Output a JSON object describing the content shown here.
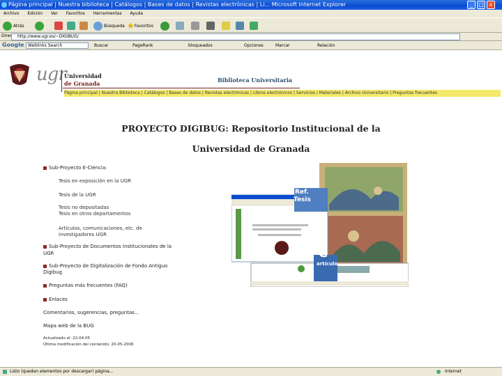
{
  "window": {
    "title": "Página principal | Nuestra biblioteca | Catálogos | Bases de datos | Revistas electrónicas | Li... Microsoft Internet Explorer",
    "buttons": [
      "_",
      "□",
      "x"
    ]
  },
  "menubar": [
    "Archivo",
    "Edición",
    "Ver",
    "Favoritos",
    "Herramientas",
    "Ayuda"
  ],
  "toolbar": {
    "back": "Atrás",
    "search": "Búsqueda",
    "favorites": "Favoritos"
  },
  "addressbar": {
    "label": "Dirección",
    "url": "http://www.ugr.es/~DIGIBUG/"
  },
  "googlebar": {
    "logo": "Google",
    "search_value": "Weblinks Search",
    "items": [
      "Buscar",
      "PageRank",
      "bloqueados",
      "Opciones",
      "Marcar",
      "Relación"
    ]
  },
  "page": {
    "logo_text": "ugr",
    "university_line1": "Universidad",
    "university_line2": "de Granada",
    "library_title": "Biblioteca Universitaria",
    "nav": [
      "Página principal",
      "Nuestra Biblioteca",
      "Catálogos",
      "Bases de datos",
      "Revistas electrónicas",
      "Libros electrónicos",
      "Servicios / Materiales",
      "Archivo Universitario",
      "Preguntas frecuentes"
    ],
    "title_line1": "PROYECTO DIGIBUG: Repositorio Institucional de la",
    "title_line2": "Universidad de Granada",
    "list": {
      "item1": "Sub-Proyecto E-Ciencia:",
      "sub1": "Tesis en exposición en la UGR",
      "sub2": "Tesis de la UGR",
      "sub3a": "Tesis no depositadas",
      "sub3b": "Tesis en otros departamentos",
      "sub4a": "Artículos, comunicaciones, etc. de",
      "sub4b": "investigadores UGR",
      "item2a": "Sub-Proyecto de Documentos Institucionales de la",
      "item2b": "UGR",
      "item3a": "Sub-Proyecto de Digitalización de Fondo Antiguo",
      "item3b": "Digibug",
      "item4": "Preguntas más frecuentes (FAQ)",
      "item5": "Enlaces",
      "line_comments": "Comentarios, sugerencias, preguntas...",
      "line_map": "Mapa web de la BUG",
      "updated": "Actualizado el: 22-04-05",
      "modified": "Última modificación del contenido: 20-05-2006"
    },
    "image_labels": {
      "ref": "Ref.",
      "tesis": "Tesis",
      "e": "e",
      "articulo": "artículo"
    }
  },
  "status": {
    "text": "Listo (quedan elementos por descargar) página...",
    "zone": "Internet"
  },
  "colors": {
    "title_bar": "#0a4bd0",
    "accent": "#7a2020",
    "nav_yellow": "#f5e96a",
    "bullet": "#8b2a2a",
    "chrome": "#ece9d8"
  }
}
